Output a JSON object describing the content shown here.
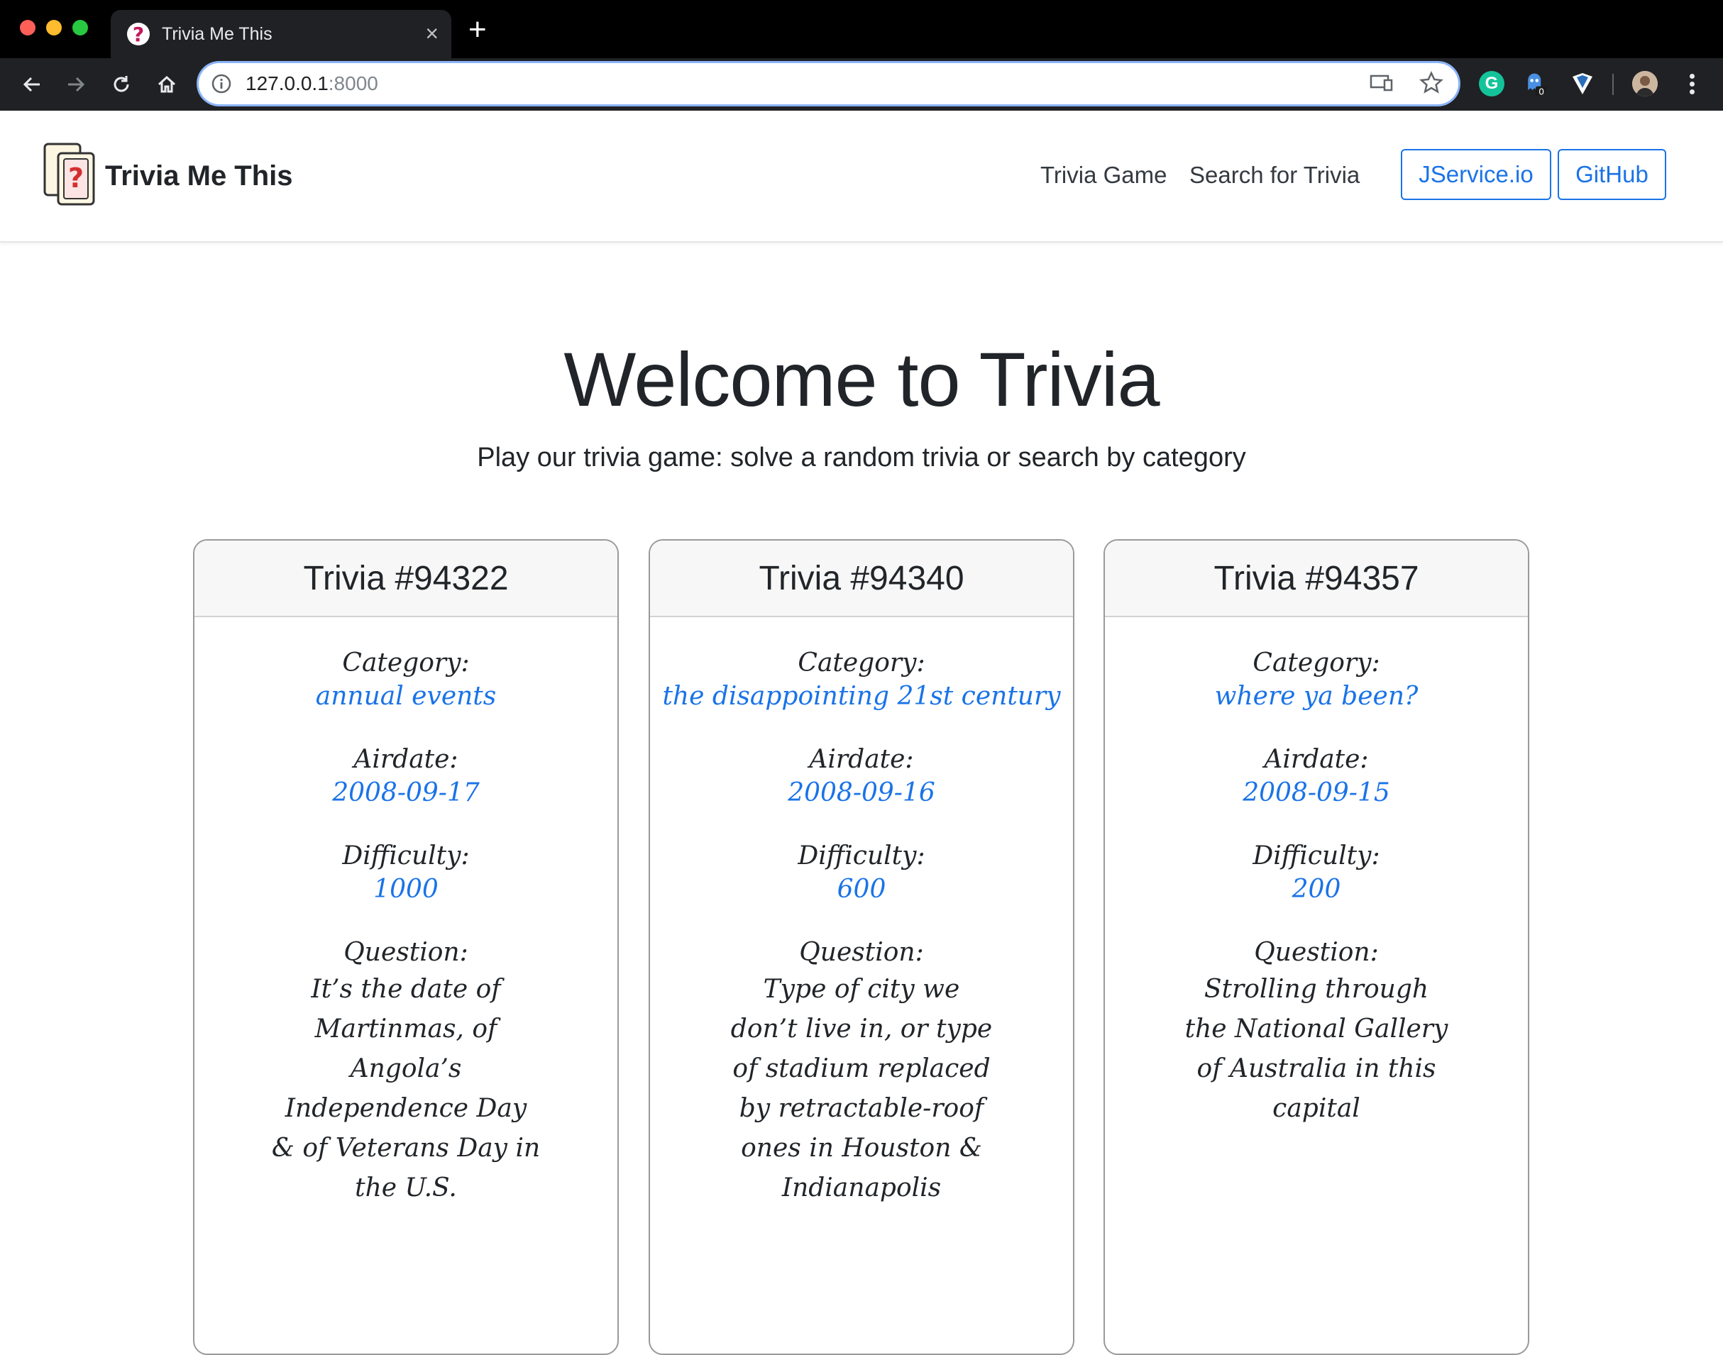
{
  "browser": {
    "tab_title": "Trivia Me This",
    "new_tab_symbol": "+",
    "close_symbol": "×",
    "url_host": "127.0.0.1",
    "url_port": ":8000",
    "extension_badge": "0",
    "grammarly_letter": "G",
    "icons": [
      "back-arrow-icon",
      "forward-arrow-icon",
      "reload-icon",
      "home-icon",
      "info-icon",
      "cast-icon",
      "star-icon",
      "grammarly-icon",
      "ghostery-icon",
      "shield-icon",
      "avatar",
      "menu-icon"
    ]
  },
  "navbar": {
    "brand": "Trivia Me This",
    "links": [
      "Trivia Game",
      "Search for Trivia"
    ],
    "buttons": [
      "JService.io",
      "GitHub"
    ],
    "accent_color": "#1a73e8"
  },
  "hero": {
    "title": "Welcome to Trivia",
    "lead": "Play our trivia game: solve a random trivia or search by category"
  },
  "labels": {
    "category": "Category:",
    "airdate": "Airdate:",
    "difficulty": "Difficulty:",
    "question": "Question:"
  },
  "cards": [
    {
      "title": "Trivia #94322",
      "category": "annual events",
      "airdate": "2008-09-17",
      "difficulty": "1000",
      "question": "It’s the date of Martinmas, of Angola’s Independence Day & of Veterans Day in the U.S."
    },
    {
      "title": "Trivia #94340",
      "category": "the disappointing 21st century",
      "airdate": "2008-09-16",
      "difficulty": "600",
      "question": "Type of city we don’t live in, or type of stadium replaced by retractable-roof ones in Houston & Indianapolis"
    },
    {
      "title": "Trivia #94357",
      "category": "where ya been?",
      "airdate": "2008-09-15",
      "difficulty": "200",
      "question": "Strolling through the National Gallery of Australia in this capital"
    }
  ]
}
